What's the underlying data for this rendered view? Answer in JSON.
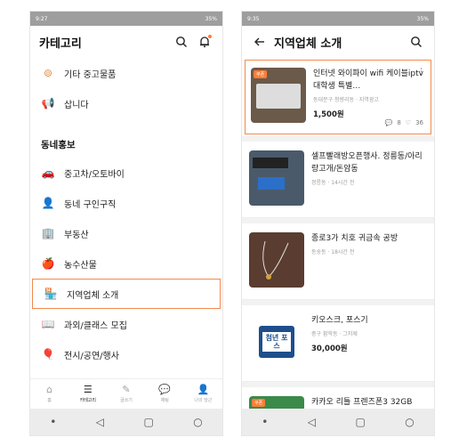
{
  "left": {
    "status": {
      "time": "9:27",
      "right": "35%"
    },
    "title": "카테고리",
    "items_top": [
      {
        "icon": "ring-icon",
        "glyph": "⊚",
        "label": "기타 중고물품"
      },
      {
        "icon": "megaphone-icon",
        "glyph": "📢",
        "label": "삽니다"
      }
    ],
    "section": "동네홍보",
    "items": [
      {
        "icon": "car-icon",
        "glyph": "🚗",
        "label": "중고차/오토바이"
      },
      {
        "icon": "person-icon",
        "glyph": "👤",
        "label": "동네 구인구직"
      },
      {
        "icon": "building-icon",
        "glyph": "🏢",
        "label": "부동산"
      },
      {
        "icon": "apple-icon",
        "glyph": "🍎",
        "label": "농수산물"
      },
      {
        "icon": "store-icon",
        "glyph": "🏪",
        "label": "지역업체 소개"
      },
      {
        "icon": "book-icon",
        "glyph": "📖",
        "label": "과외/클래스 모집"
      },
      {
        "icon": "balloon-icon",
        "glyph": "🎈",
        "label": "전시/공연/행사"
      }
    ],
    "nav": [
      {
        "label": "홈",
        "glyph": "⌂"
      },
      {
        "label": "카테고리",
        "glyph": "☰"
      },
      {
        "label": "글쓰기",
        "glyph": "✎"
      },
      {
        "label": "채팅",
        "glyph": "💬"
      },
      {
        "label": "나의 당근",
        "glyph": "👤"
      }
    ]
  },
  "right": {
    "status": {
      "time": "9:35",
      "right": "35%"
    },
    "title": "지역업체 소개",
    "items": [
      {
        "badge": "쿠폰",
        "title": "인터넷 와이파이 wifi 케이블iptv 대학생 특별…",
        "sub": "동대문구 청량리동 · 지역광고",
        "price": "1,500원",
        "chats": "8",
        "likes": "36",
        "thumb": "#6b5a4a"
      },
      {
        "badge": "",
        "title": "셀프빨래방오픈행사. 정릉동/아리랑고개/돈암동",
        "sub": "정릉동 · 14시간 전",
        "price": "",
        "thumb": "#4a5a6a"
      },
      {
        "badge": "",
        "title": "종로3가 치호 귀금속 공방",
        "sub": "동숭동 · 18시간 전",
        "price": "",
        "thumb": "#5a3d30"
      },
      {
        "badge": "",
        "title": "키오스크, 포스기",
        "sub": "중구 황학동 · 그저께",
        "price": "30,000원",
        "thumb": "#ffffff",
        "thumb_text": "첨년 포스"
      },
      {
        "badge": "쿠폰",
        "title": "카카오 리틀 프렌즈폰3 32GB",
        "sub": "",
        "price": "",
        "thumb": "#3a8a4a"
      }
    ]
  }
}
